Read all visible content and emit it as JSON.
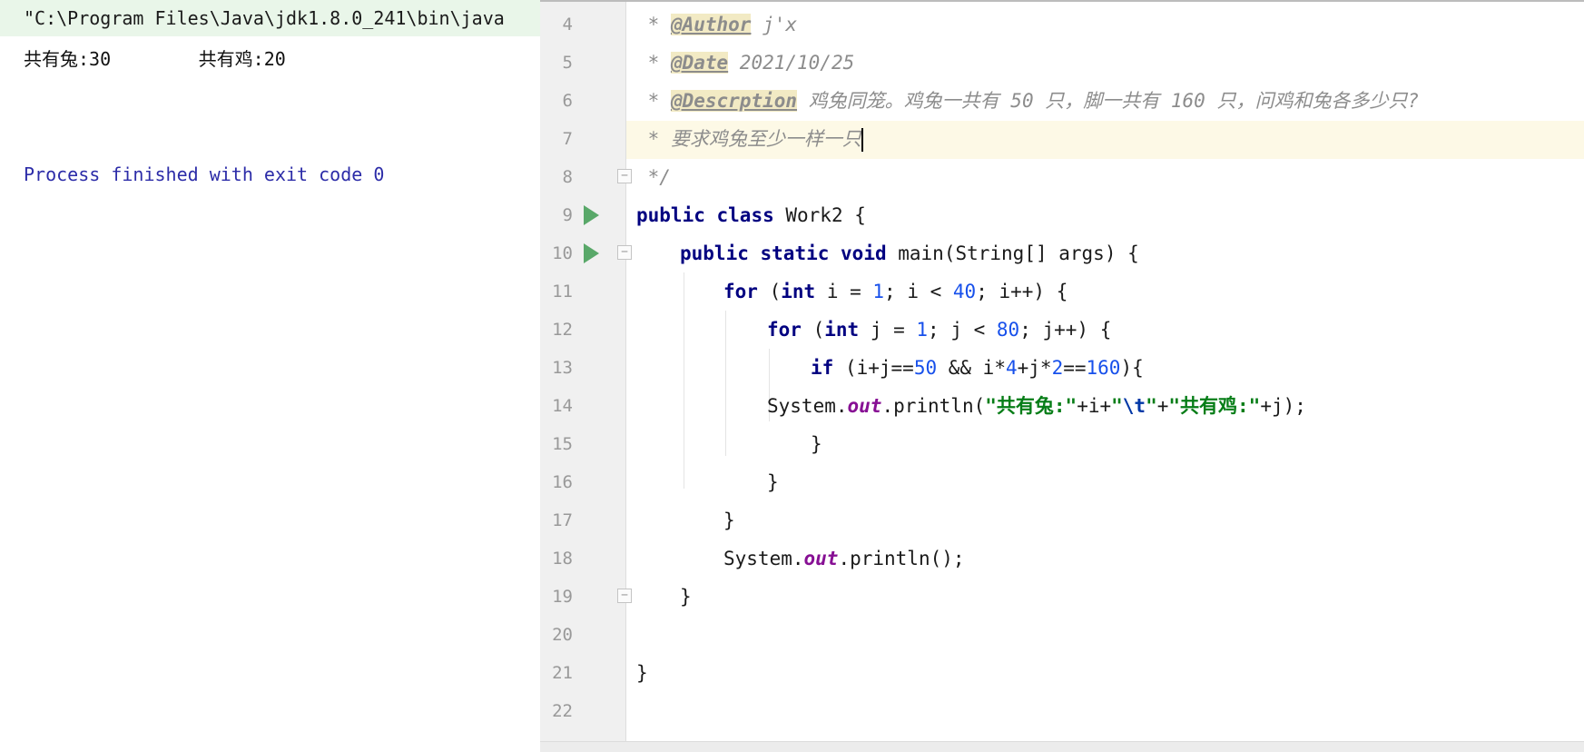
{
  "console": {
    "command": "\"C:\\Program Files\\Java\\jdk1.8.0_241\\bin\\java",
    "output": "共有兔:30\t共有鸡:20",
    "exit_message": "Process finished with exit code 0"
  },
  "editor": {
    "line_numbers": [
      "4",
      "5",
      "6",
      "7",
      "8",
      "9",
      "10",
      "11",
      "12",
      "13",
      "14",
      "15",
      "16",
      "17",
      "18",
      "19",
      "20",
      "21",
      "22"
    ],
    "doc": {
      "star": " * ",
      "author_tag": "@Author",
      "author_value": " j'x",
      "date_tag": "@Date",
      "date_value": " 2021/10/25",
      "desc_tag": "@Descrption",
      "desc_value": " 鸡兔同笼。鸡兔一共有 50 只，脚一共有 160 只，问鸡和兔各多少只?",
      "requirement": " * 要求鸡兔至少一样一只",
      "doc_end": " */"
    },
    "tokens": {
      "kw_public": "public",
      "kw_class": "class",
      "kw_static": "static",
      "kw_void": "void",
      "kw_for": "for",
      "kw_int": "int",
      "kw_if": "if",
      "class_name": " Work2 {",
      "main_sig": " main(String[] args) {",
      "for_i_a": " (",
      "for_i_b": " i = ",
      "num_1": "1",
      "for_i_c": "; i < ",
      "num_40": "40",
      "for_i_d": "; i++) {",
      "for_j_b": " j = ",
      "for_j_c": "; j < ",
      "num_80": "80",
      "for_j_d": "; j++) {",
      "if_a": " (i+j==",
      "num_50": "50",
      "if_b": " && i*",
      "num_4": "4",
      "if_c": "+j*",
      "num_2": "2",
      "if_d": "==",
      "num_160": "160",
      "if_e": "){",
      "system": "System.",
      "out": "out",
      "println_open": ".println(",
      "str_rabbit": "\"共有兔:\"",
      "plus_i_plus": "+i+",
      "str_tab_open": "\"",
      "str_tab_esc": "\\t",
      "str_tab_close": "\"",
      "plus": "+",
      "str_chicken": "\"共有鸡:\"",
      "plus_j_close": "+j);",
      "println_empty": ".println();",
      "brace": "}"
    }
  }
}
